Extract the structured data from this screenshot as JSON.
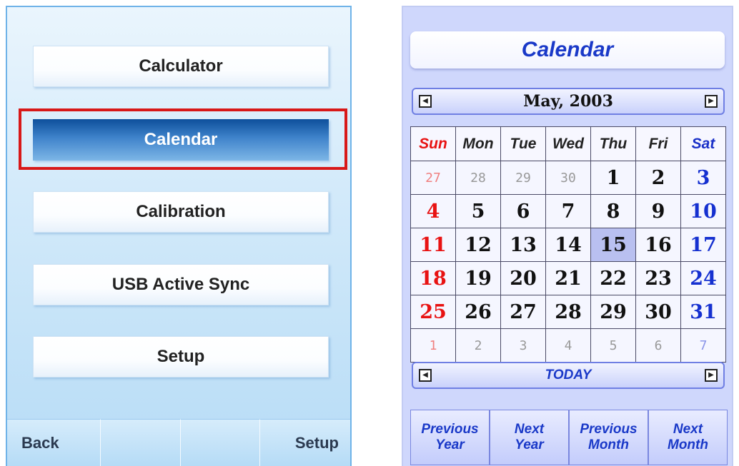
{
  "menu": {
    "items": [
      {
        "label": "Calculator"
      },
      {
        "label": "Calendar"
      },
      {
        "label": "Calibration"
      },
      {
        "label": "USB Active Sync"
      },
      {
        "label": "Setup"
      }
    ],
    "selected": "Calendar",
    "bottom_buttons": [
      "Back",
      "",
      "",
      "Setup"
    ]
  },
  "calendar": {
    "title": "Calendar",
    "month_label": "May, 2003",
    "today_label": "TODAY",
    "weekdays": [
      "Sun",
      "Mon",
      "Tue",
      "Wed",
      "Thu",
      "Fri",
      "Sat"
    ],
    "weeks": [
      [
        "27",
        "28",
        "29",
        "30",
        "1",
        "2",
        "3"
      ],
      [
        "4",
        "5",
        "6",
        "7",
        "8",
        "9",
        "10"
      ],
      [
        "11",
        "12",
        "13",
        "14",
        "15",
        "16",
        "17"
      ],
      [
        "18",
        "19",
        "20",
        "21",
        "22",
        "23",
        "24"
      ],
      [
        "25",
        "26",
        "27",
        "28",
        "29",
        "30",
        "31"
      ],
      [
        "1",
        "2",
        "3",
        "4",
        "5",
        "6",
        "7"
      ]
    ],
    "highlighted_day": "15",
    "nav_buttons": [
      "Previous\nYear",
      "Next\nYear",
      "Previous\nMonth",
      "Next\nMonth"
    ],
    "colors": {
      "sunday": "#e81212",
      "saturday": "#1530d0",
      "accent": "#1a39c8",
      "selection_frame": "#d81818"
    }
  }
}
